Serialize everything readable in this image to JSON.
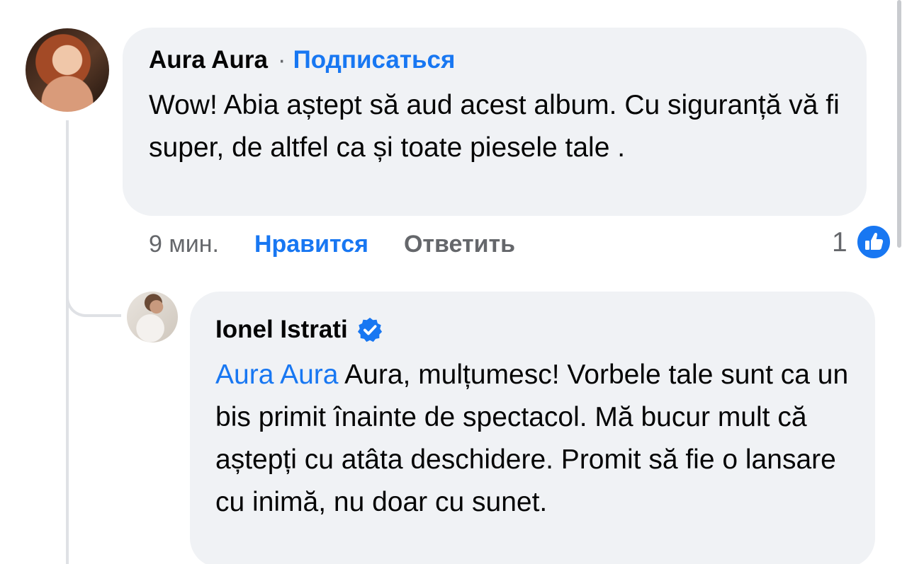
{
  "comment": {
    "author": "Aura Aura",
    "separator": "·",
    "follow_label": "Подписаться",
    "text": "Wow! Abia aștept să aud acest album. Cu siguranță vă fi super, de altfel ca și toate piesele tale .",
    "time": "9 мин.",
    "like_label": "Нравится",
    "reply_label": "Ответить",
    "reaction_count": "1",
    "reaction_icon": "like-icon"
  },
  "reply": {
    "author": "Ionel Istrati",
    "verified_icon": "verified-badge-icon",
    "mention": "Aura Aura",
    "text": " Aura, mulțumesc! Vorbele tale sunt ca un bis primit înainte de spectacol. Mă bucur mult că aștepți cu atâta deschidere. Promit să fie o lansare cu inimă, nu doar cu sunet."
  },
  "colors": {
    "link_blue": "#1877f2",
    "bubble_bg": "#f0f2f5",
    "secondary_text": "#65676b",
    "thread_line": "#dfe1e5"
  }
}
